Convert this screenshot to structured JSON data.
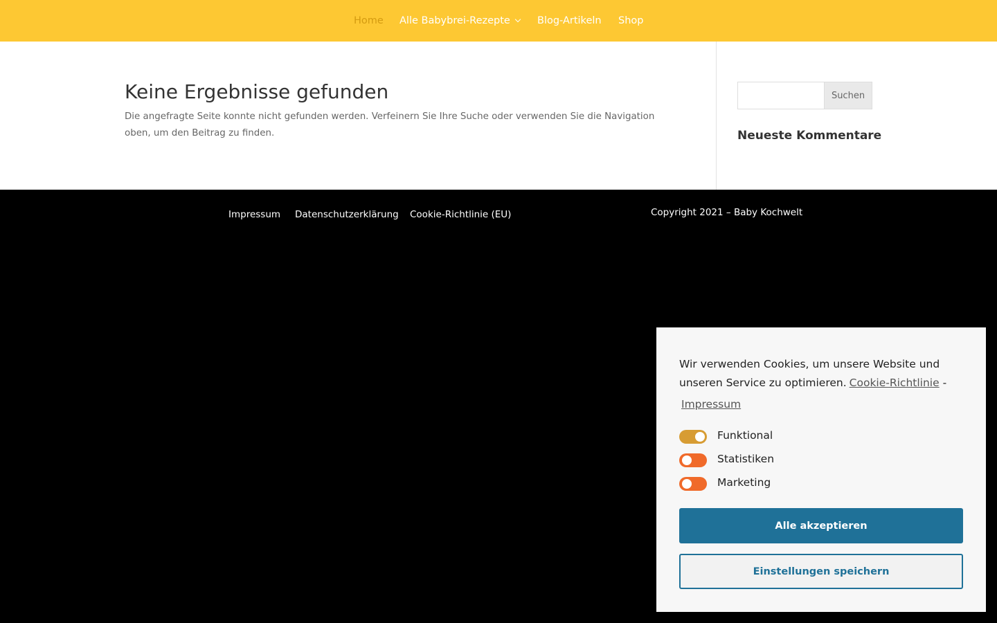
{
  "nav": {
    "items": [
      {
        "label": "Home",
        "active": true
      },
      {
        "label": "Alle Babybrei-Rezepte",
        "has_dropdown": true
      },
      {
        "label": "Blog-Artikeln"
      },
      {
        "label": "Shop"
      }
    ]
  },
  "main": {
    "title": "Keine Ergebnisse gefunden",
    "description": "Die angefragte Seite konnte nicht gefunden werden. Verfeinern Sie Ihre Suche oder verwenden Sie die Navigation oben, um den Beitrag zu finden."
  },
  "sidebar": {
    "search": {
      "value": "",
      "button_label": "Suchen"
    },
    "widget_title": "Neueste Kommentare"
  },
  "footer": {
    "links": [
      "Impressum",
      "Datenschutzerklärung",
      "Cookie-Richtlinie (EU)"
    ],
    "copyright": "Copyright 2021 – Baby Kochwelt"
  },
  "cookie_banner": {
    "text": "Wir verwenden Cookies, um unsere Website und unseren Service zu optimieren.",
    "policy_link": "Cookie-Richtlinie",
    "separator": "-",
    "impressum_link": "Impressum",
    "options": [
      {
        "label": "Funktional",
        "enabled": true
      },
      {
        "label": "Statistiken",
        "enabled": false
      },
      {
        "label": "Marketing",
        "enabled": false
      }
    ],
    "accept_all_label": "Alle akzeptieren",
    "save_settings_label": "Einstellungen speichern"
  },
  "colors": {
    "header_bg": "#fdc833",
    "nav_active": "#d49b11",
    "accent_blue": "#1f7198",
    "toggle_on": "#d79c33",
    "toggle_off": "#f06a2a",
    "footer_bg": "#000000"
  }
}
